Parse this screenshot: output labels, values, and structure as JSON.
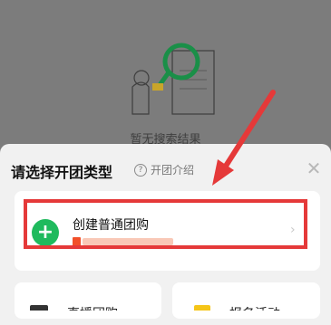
{
  "background": {
    "empty_state_text": "暂无搜索结果",
    "illustration_icon": "search-magnifier-illustration"
  },
  "sheet": {
    "title": "请选择开团类型",
    "intro_label": "开团介绍",
    "intro_icon": "help-circle-icon",
    "close_icon": "close-icon"
  },
  "options": {
    "main": {
      "label": "创建普通团购",
      "icon": "plus-circle-icon",
      "accent_color": "#1fba5d"
    },
    "bottom_left": {
      "label": "直播团购"
    },
    "bottom_right": {
      "label": "报名活动"
    }
  },
  "annotation": {
    "color": "#e53939"
  }
}
